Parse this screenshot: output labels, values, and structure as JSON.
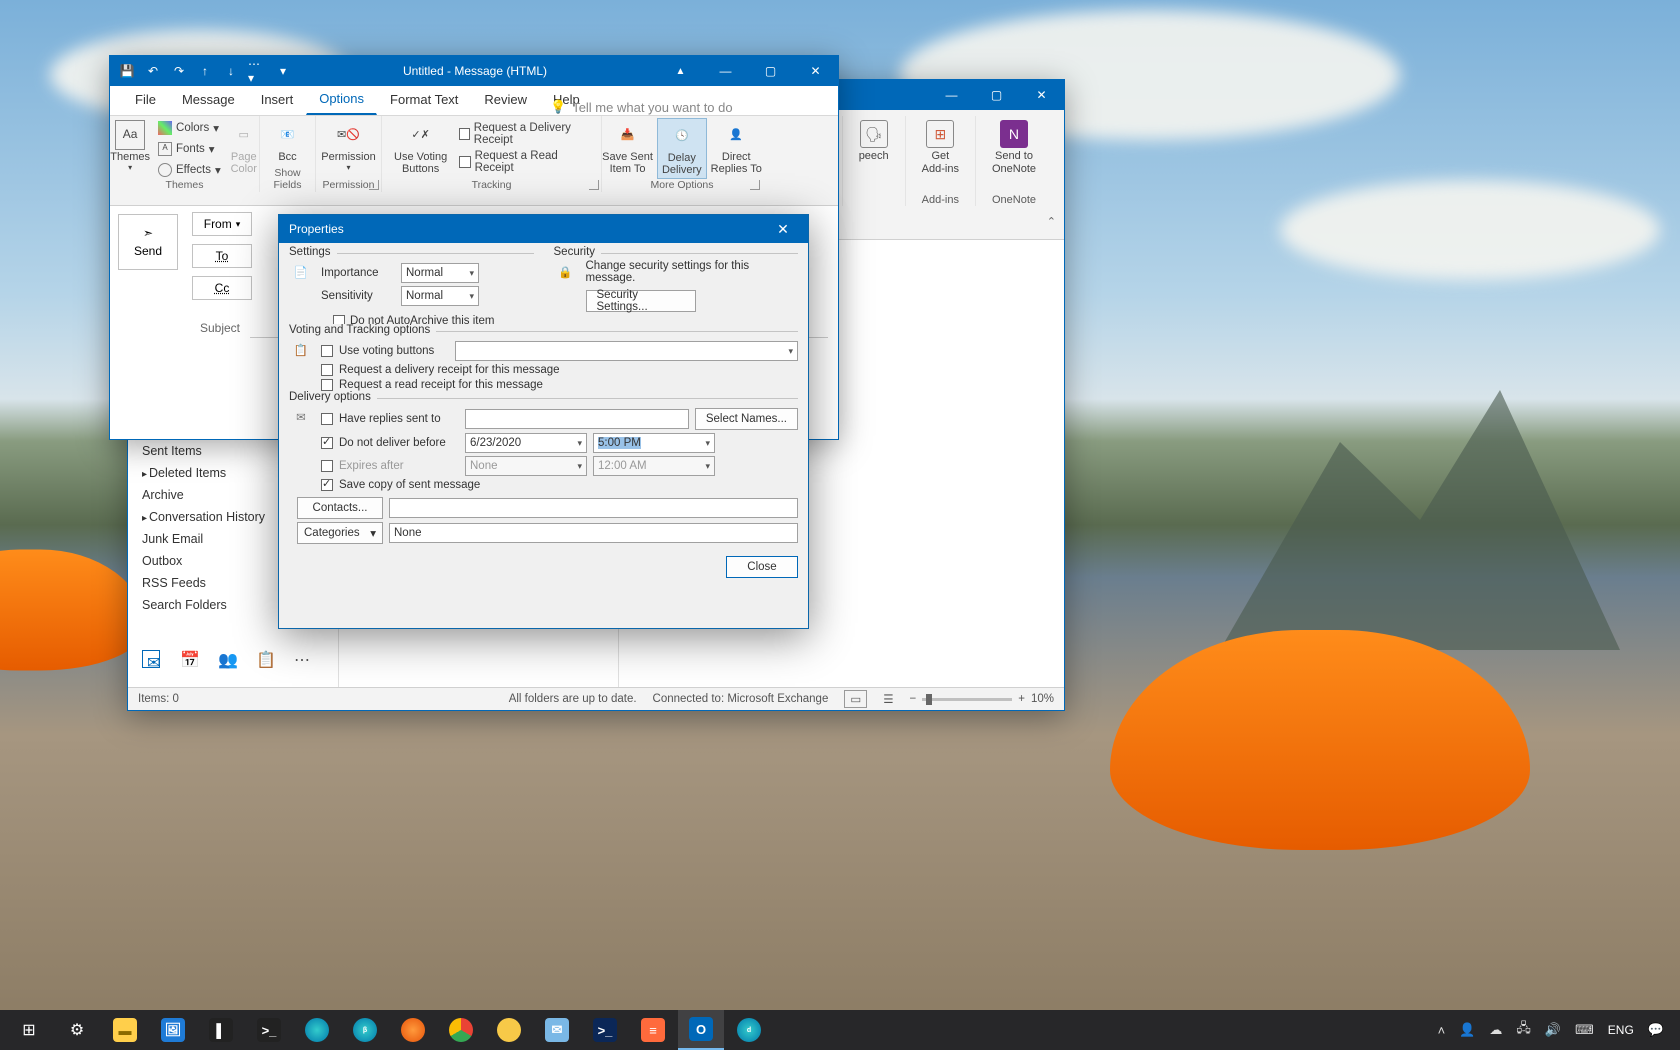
{
  "msg_window": {
    "title": "Untitled  -  Message (HTML)",
    "tabs": {
      "file": "File",
      "message": "Message",
      "insert": "Insert",
      "options": "Options",
      "format": "Format Text",
      "review": "Review",
      "help": "Help"
    },
    "tellme": "Tell me what you want to do",
    "ribbon": {
      "themes": {
        "label": "Themes",
        "colors": "Colors",
        "fonts": "Fonts",
        "effects": "Effects",
        "pagecolor": "Page\nColor",
        "themes_btn": "Themes"
      },
      "show_fields": {
        "label": "Show Fields",
        "bcc": "Bcc"
      },
      "permission": {
        "label": "Permission",
        "btn": "Permission"
      },
      "tracking": {
        "label": "Tracking",
        "voting": "Use Voting\nButtons",
        "reqdel": "Request a Delivery Receipt",
        "reqread": "Request a Read Receipt"
      },
      "more": {
        "label": "More Options",
        "savesent": "Save Sent\nItem To",
        "delay": "Delay\nDelivery",
        "direct": "Direct\nReplies To"
      }
    },
    "send": "Send",
    "from": "From",
    "to": "To",
    "cc": "Cc",
    "subject": "Subject"
  },
  "back_window": {
    "ribbon": {
      "speech": "peech",
      "addins": "Get\nAdd-ins",
      "addins_g": "Add-ins",
      "onenote": "Send to\nOneNote",
      "onenote_g": "OneNote"
    }
  },
  "nav": {
    "sent": "Sent Items",
    "deleted": "Deleted Items",
    "archive": "Archive",
    "conv": "Conversation History",
    "junk": "Junk Email",
    "outbox": "Outbox",
    "rss": "RSS Feeds",
    "search": "Search Folders"
  },
  "status": {
    "items": "Items: 0",
    "sync": "All folders are up to date.",
    "conn": "Connected to: Microsoft Exchange",
    "zoom": "10%"
  },
  "props": {
    "title": "Properties",
    "settings": "Settings",
    "security": "Security",
    "importance_l": "Importance",
    "importance_v": "Normal",
    "sensitivity_l": "Sensitivity",
    "sensitivity_v": "Normal",
    "noarchive": "Do not AutoArchive this item",
    "secdesc": "Change security settings for this message.",
    "secbtn": "Security Settings...",
    "voting_h": "Voting and Tracking options",
    "usevote": "Use voting buttons",
    "reqdel": "Request a delivery receipt for this message",
    "reqread": "Request a read receipt for this message",
    "delivery_h": "Delivery options",
    "replies": "Have replies sent to",
    "selectnames": "Select Names...",
    "notbefore": "Do not deliver before",
    "notbefore_date": "6/23/2020",
    "notbefore_time": "5:00 PM",
    "expires": "Expires after",
    "expires_date": "None",
    "expires_time": "12:00 AM",
    "savecopy": "Save copy of sent message",
    "contacts": "Contacts...",
    "categories": "Categories",
    "categories_v": "None",
    "close": "Close"
  },
  "taskbar": {
    "lang": "ENG"
  }
}
